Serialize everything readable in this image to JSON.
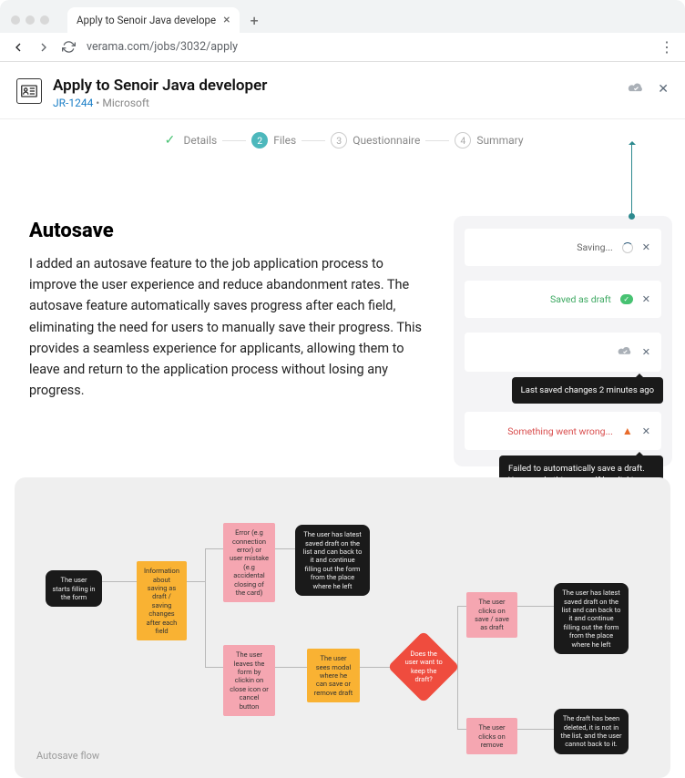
{
  "browser": {
    "tab_title": "Apply to Senoir Java develope",
    "url": "verama.com/jobs/3032/apply"
  },
  "header": {
    "title": "Apply to Senoir Java developer",
    "job_ref": "JR-1244",
    "separator": "•",
    "company": "Microsoft"
  },
  "stepper": {
    "steps": [
      {
        "num": "✓",
        "label": "Details",
        "state": "done"
      },
      {
        "num": "2",
        "label": "Files",
        "state": "active"
      },
      {
        "num": "3",
        "label": "Questionnaire",
        "state": "idle"
      },
      {
        "num": "4",
        "label": "Summary",
        "state": "idle"
      }
    ]
  },
  "content": {
    "heading": "Autosave",
    "paragraph": "I added an autosave feature to the job application process to improve the user experience and reduce abandonment rates. The autosave feature automatically saves progress after each field, eliminating the need for users to manually save their progress. This provides a seamless experience for applicants, allowing them to leave and return to the application process without losing any progress."
  },
  "notifications": {
    "saving": "Saving...",
    "saved": "Saved as draft",
    "last_saved_tooltip": "Last saved changes 2 minutes ago",
    "error": "Something went wrong...",
    "error_tooltip": "Failed to automatically save a draft. You can do this yourself by clicking Close button on the right"
  },
  "flow": {
    "caption": "Autosave flow",
    "nodes": {
      "start": "The user starts filling in the form",
      "info": "Information about saving as draft / saving changes after each field",
      "error": "Error (e.g connection error) or user mistake (e.g accidental closing of the card)",
      "latest1": "The user has latest saved draft on the list and can back to it and continue filling out the form from the place where he left",
      "leaves": "The user leaves the form by clickin on close icon or cancel button",
      "modal": "The user sees modal where he can save or remove draft",
      "decision": "Does the user want to keep the draft?",
      "click_save": "The user clicks on save / save as draft",
      "latest2": "The user has latest saved draft on the list and can back to it and continue filling out the form from the place where he left",
      "click_remove": "The user clicks on remove",
      "deleted": "The draft has been deleted, it is not in the list, and the user cannot back to it."
    }
  }
}
